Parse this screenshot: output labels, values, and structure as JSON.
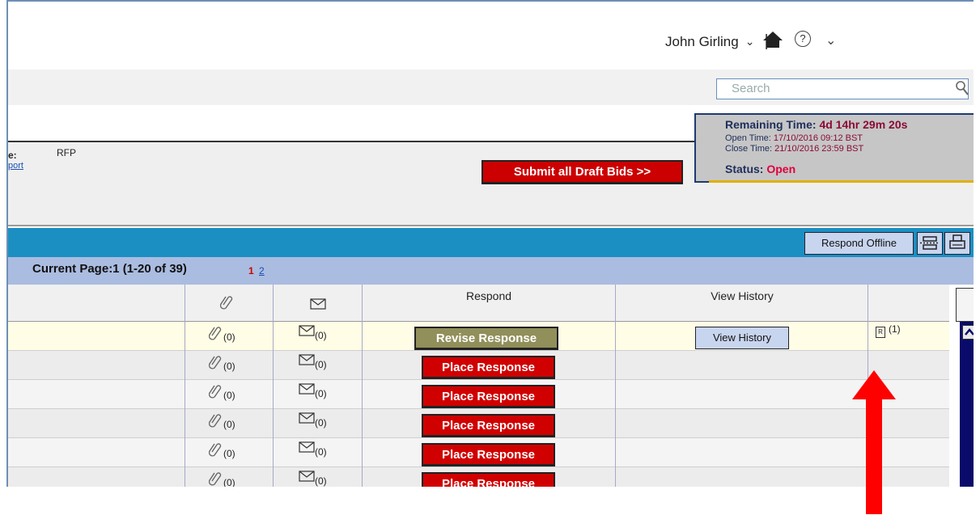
{
  "header": {
    "user_name": "John Girling",
    "separator": "|",
    "help_glyph": "?"
  },
  "search": {
    "placeholder": "Search"
  },
  "info": {
    "label_suffix": "e:",
    "label_value": "RFP",
    "link_fragment": "port",
    "submit_label": "Submit all Draft Bids >>"
  },
  "timer": {
    "remaining_label": "Remaining Time:",
    "remaining_value": "4d 14hr 29m 20s",
    "open_label": "Open Time:",
    "open_value": "17/10/2016 09:12 BST",
    "close_label": "Close Time:",
    "close_value": "21/10/2016 23:59 BST",
    "status_label": "Status:",
    "status_value": "Open"
  },
  "toolbar": {
    "respond_offline": "Respond Offline"
  },
  "pager": {
    "current_page": "Current Page:1  (1-20 of 39)",
    "page1": "1",
    "page2": "2"
  },
  "table": {
    "headers": {
      "respond": "Respond",
      "view_history": "View History"
    },
    "rows": [
      {
        "attach": "(0)",
        "msg": "(0)",
        "action": "Revise Response"
      },
      {
        "attach": "(0)",
        "msg": "(0)",
        "action": "Place Response"
      },
      {
        "attach": "(0)",
        "msg": "(0)",
        "action": "Place Response"
      },
      {
        "attach": "(0)",
        "msg": "(0)",
        "action": "Place Response"
      },
      {
        "attach": "(0)",
        "msg": "(0)",
        "action": "Place Response"
      },
      {
        "attach": "(0)",
        "msg": "(0)",
        "action": "Place Response"
      }
    ],
    "view_history_button": "View History",
    "r_tag_letter": "R",
    "r_tag_count": "(1)"
  },
  "colors": {
    "accent_blue": "#1b8fc2",
    "action_red": "#d00000",
    "revise_olive": "#918f5a",
    "status_red": "#e0003c"
  }
}
